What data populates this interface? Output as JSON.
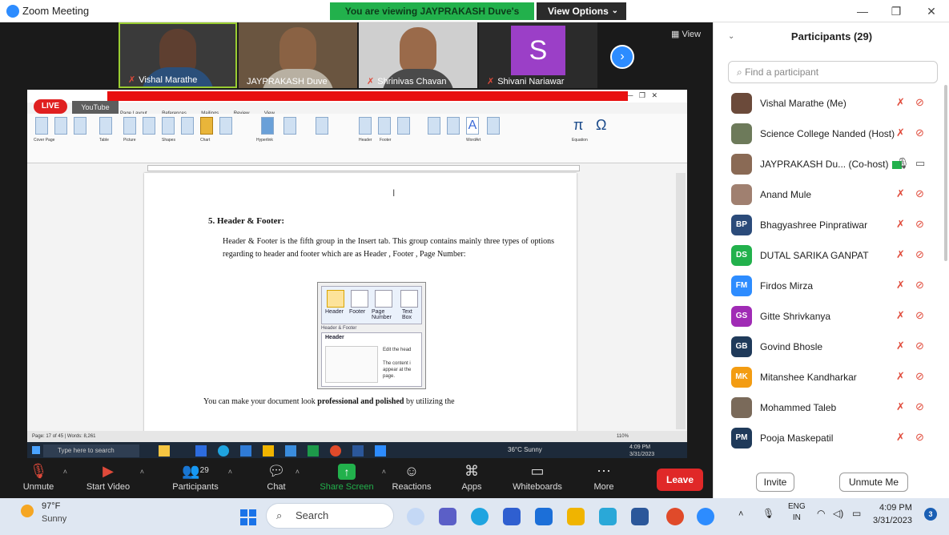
{
  "window": {
    "title": "Zoom Meeting",
    "controls": [
      "—",
      "❐",
      "✕"
    ]
  },
  "banner": {
    "viewing": "You are viewing JAYPRAKASH Duve's screen",
    "view_options": "View Options"
  },
  "stage": {
    "view_label": "View",
    "thumbnails": [
      {
        "name": "Vishal Marathe",
        "muted": true
      },
      {
        "name": "JAYPRAKASH Duve",
        "muted": false
      },
      {
        "name": "Shrinivas Chavan",
        "muted": true
      },
      {
        "name": "Shivani Nariawar",
        "muted": true,
        "initial": "S"
      }
    ]
  },
  "word": {
    "live": "LIVE",
    "youtube": "YouTube",
    "tabs": [
      "Page Layout",
      "References",
      "Mailings",
      "Review",
      "View"
    ],
    "ribbon_labels": [
      "Cover Page",
      "Blank Page",
      "Page Break",
      "Table",
      "Picture",
      "Clip Art",
      "Shapes",
      "SmartArt",
      "Chart",
      "Screenshot",
      "Hyperlink",
      "Bookmark",
      "Cross-reference",
      "Header",
      "Footer",
      "Page Number",
      "Text Box",
      "Quick Parts",
      "WordArt",
      "Drop Cap",
      "Equation",
      "Symbol"
    ],
    "heading": "5.  Header & Footer:",
    "paragraph": "Header & Footer is the fifth group in the Insert tab. This group contains mainly three types of options regarding to header and footer which are as  Header ,  Footer , Page Number:",
    "bottom_pre": "You can make your document look ",
    "bottom_bold": "professional and polished",
    "bottom_post": " by utilizing the",
    "inset": {
      "buttons": [
        "Header",
        "Footer",
        "Page Number",
        "Text Box"
      ],
      "group": "Header & Footer",
      "panel_title": "Header",
      "edit": "Edit the head",
      "desc": "The content i appear at the page."
    },
    "status": "Page: 17 of 45   |   Words: 8,261",
    "zoom": "110%"
  },
  "inner_taskbar": {
    "search": "Type here to search",
    "weather": "36°C  Sunny",
    "time": "4:09 PM",
    "date": "3/31/2023"
  },
  "toolbar": {
    "unmute": "Unmute",
    "start_video": "Start Video",
    "participants": "Participants",
    "participants_count": "29",
    "chat": "Chat",
    "share": "Share Screen",
    "reactions": "Reactions",
    "apps": "Apps",
    "whiteboards": "Whiteboards",
    "more": "More",
    "leave": "Leave"
  },
  "participants": {
    "title": "Participants (29)",
    "search_placeholder": "Find a participant",
    "list": [
      {
        "name": "Vishal Marathe (Me)",
        "avatar": "",
        "color": "#6b4a3a"
      },
      {
        "name": "Science College Nanded (Host)",
        "avatar": "",
        "color": "#6d7a5a"
      },
      {
        "name": "JAYPRAKASH Du... (Co-host)",
        "avatar": "",
        "color": "#8a6a55"
      },
      {
        "name": "Anand Mule",
        "avatar": "",
        "color": "#a08070"
      },
      {
        "name": "Bhagyashree Pinpratiwar",
        "avatar": "BP",
        "color": "#2b4b7a"
      },
      {
        "name": "DUTAL SARIKA GANPAT",
        "avatar": "DS",
        "color": "#22b14c"
      },
      {
        "name": "Firdos Mirza",
        "avatar": "FM",
        "color": "#2d8cff"
      },
      {
        "name": "Gitte Shrivkanya",
        "avatar": "GS",
        "color": "#a02bb5"
      },
      {
        "name": "Govind Bhosle",
        "avatar": "GB",
        "color": "#1f3a5a"
      },
      {
        "name": "Mitanshee Kandharkar",
        "avatar": "MK",
        "color": "#f39c12"
      },
      {
        "name": "Mohammed Taleb",
        "avatar": "",
        "color": "#7a6a5a"
      },
      {
        "name": "Pooja Maskepatil",
        "avatar": "PM",
        "color": "#1f3a5a"
      }
    ],
    "invite": "Invite",
    "unmute_me": "Unmute Me"
  },
  "taskbar": {
    "weather_temp": "97°F",
    "weather_desc": "Sunny",
    "search": "Search",
    "lang1": "ENG",
    "lang2": "IN",
    "time": "4:09 PM",
    "date": "3/31/2023",
    "notifications": "3"
  }
}
